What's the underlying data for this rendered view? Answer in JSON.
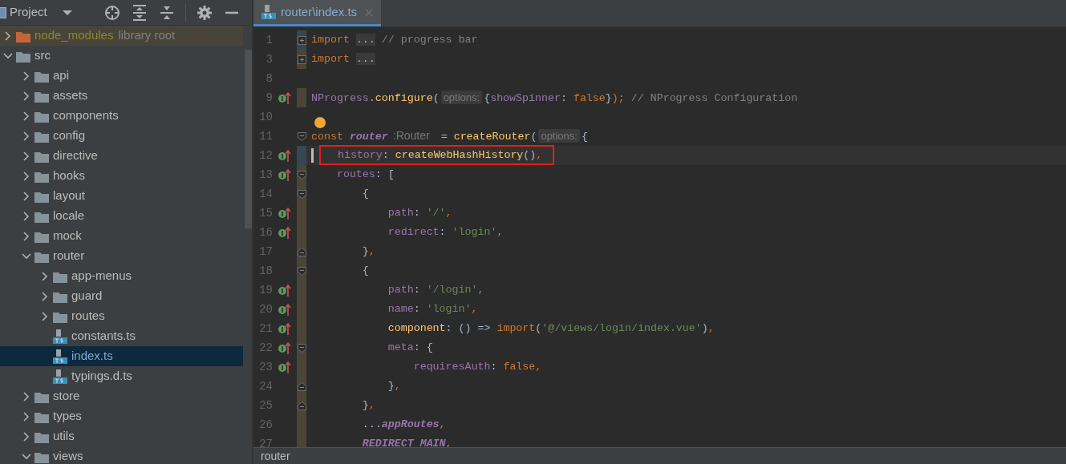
{
  "project_panel": {
    "title": "Project",
    "tree": [
      {
        "name": "node_modules",
        "kind": "library",
        "suffix": "library root",
        "expanded": false,
        "selected": false
      },
      {
        "name": "src",
        "kind": "folder",
        "expanded": true,
        "selected": false,
        "children": [
          {
            "name": "api",
            "kind": "folder",
            "expanded": false,
            "selected": false
          },
          {
            "name": "assets",
            "kind": "folder",
            "expanded": false,
            "selected": false
          },
          {
            "name": "components",
            "kind": "folder",
            "expanded": false,
            "selected": false
          },
          {
            "name": "config",
            "kind": "folder",
            "expanded": false,
            "selected": false
          },
          {
            "name": "directive",
            "kind": "folder",
            "expanded": false,
            "selected": false
          },
          {
            "name": "hooks",
            "kind": "folder",
            "expanded": false,
            "selected": false
          },
          {
            "name": "layout",
            "kind": "folder",
            "expanded": false,
            "selected": false
          },
          {
            "name": "locale",
            "kind": "folder",
            "expanded": false,
            "selected": false
          },
          {
            "name": "mock",
            "kind": "folder",
            "expanded": false,
            "selected": false
          },
          {
            "name": "router",
            "kind": "folder",
            "expanded": true,
            "selected": false,
            "children": [
              {
                "name": "app-menus",
                "kind": "folder",
                "expanded": false,
                "selected": false
              },
              {
                "name": "guard",
                "kind": "folder",
                "expanded": false,
                "selected": false
              },
              {
                "name": "routes",
                "kind": "folder",
                "expanded": false,
                "selected": false
              },
              {
                "name": "constants.ts",
                "kind": "ts",
                "selected": false
              },
              {
                "name": "index.ts",
                "kind": "ts",
                "selected": true
              },
              {
                "name": "typings.d.ts",
                "kind": "ts",
                "selected": false
              }
            ]
          },
          {
            "name": "store",
            "kind": "folder",
            "expanded": false,
            "selected": false
          },
          {
            "name": "types",
            "kind": "folder",
            "expanded": false,
            "selected": false
          },
          {
            "name": "utils",
            "kind": "folder",
            "expanded": false,
            "selected": false
          },
          {
            "name": "views",
            "kind": "folder",
            "expanded": true,
            "selected": false
          }
        ]
      }
    ]
  },
  "editor": {
    "tabs": [
      {
        "label": "router\\index.ts",
        "selected": true
      }
    ],
    "lines": [
      {
        "number": "1",
        "fold": {
          "kind": "expand"
        },
        "change": {
          "kind": "modified"
        },
        "override": false,
        "tokens": [
          {
            "kind": "kw",
            "text": "import "
          },
          {
            "kind": "folded",
            "text": "..."
          },
          {
            "kind": "comment",
            "text": " // progress bar"
          }
        ]
      },
      {
        "number": "3",
        "fold": {
          "kind": "expand"
        },
        "change": {
          "kind": "added"
        },
        "override": false,
        "tokens": [
          {
            "kind": "kw",
            "text": "import "
          },
          {
            "kind": "folded",
            "text": "..."
          }
        ]
      },
      {
        "number": "8",
        "override": false
      },
      {
        "number": "9",
        "change": {
          "kind": "added"
        },
        "override": true,
        "tokens": [
          {
            "kind": "prop",
            "text": "NProgress"
          },
          {
            "kind": "plain",
            "text": "."
          },
          {
            "kind": "fn",
            "text": "configure"
          },
          {
            "kind": "plain",
            "text": "("
          },
          {
            "kind": "hint",
            "text": "options:"
          },
          {
            "kind": "plain",
            "text": "{"
          },
          {
            "kind": "prop",
            "text": "showSpinner"
          },
          {
            "kind": "plain",
            "text": ": "
          },
          {
            "kind": "kw",
            "text": "false"
          },
          {
            "kind": "plain",
            "text": "}"
          },
          {
            "kind": "kw",
            "text": "); "
          },
          {
            "kind": "comment",
            "text": "// NProgress Configuration"
          }
        ]
      },
      {
        "number": "10",
        "override": false
      },
      {
        "number": "11",
        "fold": {
          "kind": "open"
        },
        "override": false,
        "bulb": true,
        "tokens": [
          {
            "kind": "kw",
            "text": "const "
          },
          {
            "kind": "var",
            "text": "router"
          },
          {
            "kind": "typehint",
            "text": ":Router"
          },
          {
            "kind": "plain",
            "text": " = "
          },
          {
            "kind": "fn",
            "text": "createRouter"
          },
          {
            "kind": "plain",
            "text": "("
          },
          {
            "kind": "hint",
            "text": "options:"
          },
          {
            "kind": "plain",
            "text": "{"
          }
        ]
      },
      {
        "number": "12",
        "change": {
          "kind": "modified"
        },
        "override": true,
        "current": true,
        "boxed": true,
        "tokens": [
          {
            "kind": "prop",
            "text": "history"
          },
          {
            "kind": "plain",
            "text": ": "
          },
          {
            "kind": "fn",
            "text": "createWebHashHistory"
          },
          {
            "kind": "plain",
            "text": "()"
          },
          {
            "kind": "kw",
            "text": ","
          }
        ]
      },
      {
        "number": "13",
        "fold": {
          "kind": "open"
        },
        "change": {
          "kind": "added"
        },
        "override": true,
        "tokens": [
          {
            "kind": "prop",
            "text": "    routes"
          },
          {
            "kind": "plain",
            "text": ": ["
          }
        ]
      },
      {
        "number": "14",
        "fold": {
          "kind": "open"
        },
        "change": {
          "kind": "added"
        },
        "override": false,
        "tokens": [
          {
            "kind": "plain",
            "text": "        {"
          }
        ]
      },
      {
        "number": "15",
        "change": {
          "kind": "added"
        },
        "override": true,
        "tokens": [
          {
            "kind": "prop",
            "text": "            path"
          },
          {
            "kind": "plain",
            "text": ": "
          },
          {
            "kind": "str",
            "text": "'/'"
          },
          {
            "kind": "kw",
            "text": ","
          }
        ]
      },
      {
        "number": "16",
        "change": {
          "kind": "added"
        },
        "override": true,
        "tokens": [
          {
            "kind": "prop",
            "text": "            redirect"
          },
          {
            "kind": "plain",
            "text": ": "
          },
          {
            "kind": "str",
            "text": "'login'"
          },
          {
            "kind": "kw",
            "text": ","
          }
        ]
      },
      {
        "number": "17",
        "fold": {
          "kind": "close"
        },
        "change": {
          "kind": "added"
        },
        "override": false,
        "tokens": [
          {
            "kind": "plain",
            "text": "        }"
          },
          {
            "kind": "kw",
            "text": ","
          }
        ]
      },
      {
        "number": "18",
        "fold": {
          "kind": "open"
        },
        "change": {
          "kind": "added"
        },
        "override": false,
        "tokens": [
          {
            "kind": "plain",
            "text": "        {"
          }
        ]
      },
      {
        "number": "19",
        "change": {
          "kind": "added"
        },
        "override": true,
        "tokens": [
          {
            "kind": "prop",
            "text": "            path"
          },
          {
            "kind": "plain",
            "text": ": "
          },
          {
            "kind": "str",
            "text": "'/login'"
          },
          {
            "kind": "kw",
            "text": ","
          }
        ]
      },
      {
        "number": "20",
        "change": {
          "kind": "added"
        },
        "override": true,
        "tokens": [
          {
            "kind": "prop",
            "text": "            name"
          },
          {
            "kind": "plain",
            "text": ": "
          },
          {
            "kind": "str",
            "text": "'login'"
          },
          {
            "kind": "kw",
            "text": ","
          }
        ]
      },
      {
        "number": "21",
        "change": {
          "kind": "added"
        },
        "override": true,
        "tokens": [
          {
            "kind": "fn",
            "text": "            component"
          },
          {
            "kind": "plain",
            "text": ": () => "
          },
          {
            "kind": "kw",
            "text": "import"
          },
          {
            "kind": "plain",
            "text": "("
          },
          {
            "kind": "str",
            "text": "'@/views/login/index.vue'"
          },
          {
            "kind": "plain",
            "text": ")"
          },
          {
            "kind": "kw",
            "text": ","
          }
        ]
      },
      {
        "number": "22",
        "fold": {
          "kind": "open"
        },
        "change": {
          "kind": "added"
        },
        "override": true,
        "tokens": [
          {
            "kind": "prop",
            "text": "            meta"
          },
          {
            "kind": "plain",
            "text": ": {"
          }
        ]
      },
      {
        "number": "23",
        "change": {
          "kind": "added"
        },
        "override": true,
        "tokens": [
          {
            "kind": "prop",
            "text": "                requiresAuth"
          },
          {
            "kind": "plain",
            "text": ": "
          },
          {
            "kind": "kw",
            "text": "false"
          },
          {
            "kind": "kw",
            "text": ","
          }
        ]
      },
      {
        "number": "24",
        "fold": {
          "kind": "close"
        },
        "change": {
          "kind": "added"
        },
        "override": false,
        "tokens": [
          {
            "kind": "plain",
            "text": "            }"
          },
          {
            "kind": "kw",
            "text": ","
          }
        ]
      },
      {
        "number": "25",
        "fold": {
          "kind": "close"
        },
        "change": {
          "kind": "added"
        },
        "override": false,
        "tokens": [
          {
            "kind": "plain",
            "text": "        }"
          },
          {
            "kind": "kw",
            "text": ","
          }
        ]
      },
      {
        "number": "26",
        "change": {
          "kind": "added"
        },
        "override": false,
        "tokens": [
          {
            "kind": "plain",
            "text": "        ..."
          },
          {
            "kind": "var",
            "text": "appRoutes"
          },
          {
            "kind": "kw",
            "text": ","
          }
        ]
      },
      {
        "number": "27",
        "change": {
          "kind": "added"
        },
        "override": false,
        "tokens": [
          {
            "kind": "var",
            "text": "        REDIRECT_MAIN"
          },
          {
            "kind": "kw",
            "text": ","
          }
        ]
      }
    ]
  },
  "status_bar": {
    "breadcrumb": "router"
  }
}
